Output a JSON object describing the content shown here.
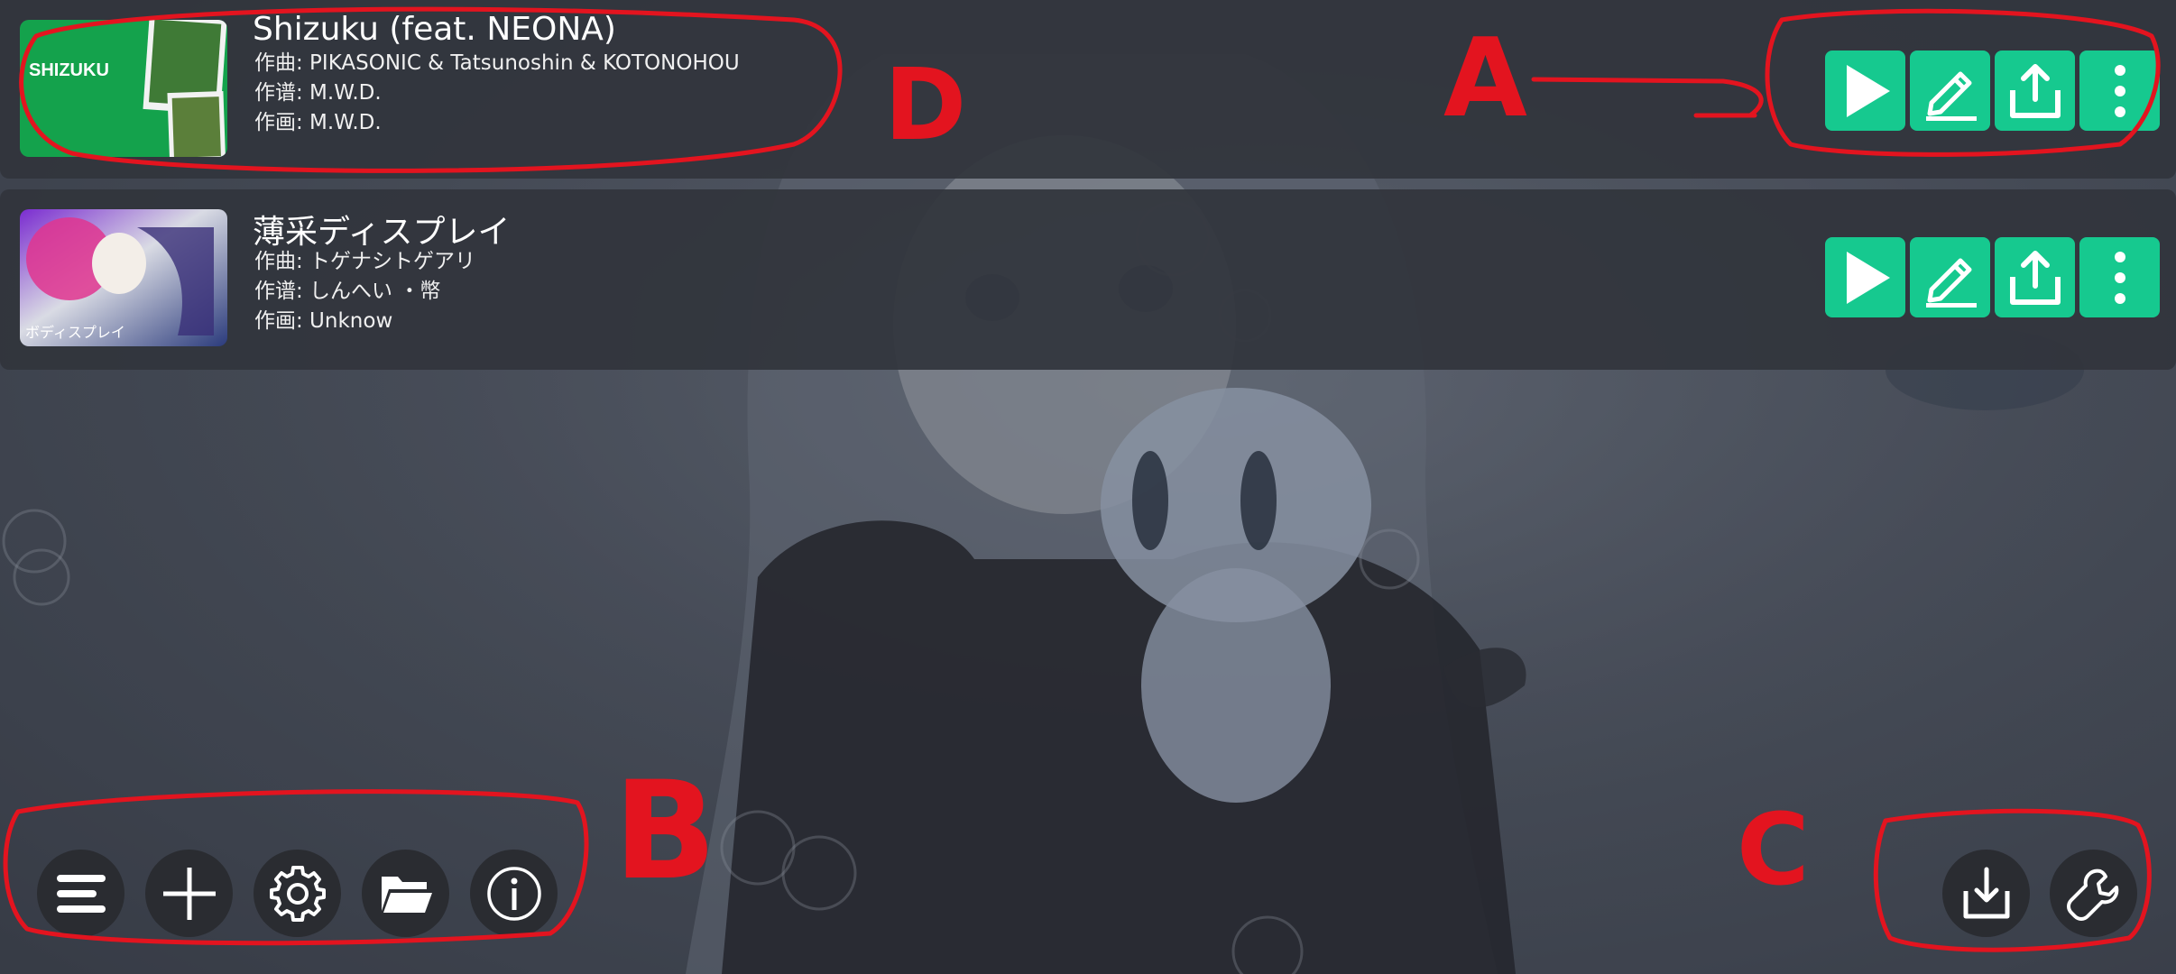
{
  "songs": [
    {
      "title": "Shizuku (feat. NEONA)",
      "composer": "作曲: PIKASONIC & Tatsunoshin & KOTONOHOU",
      "charter": "作谱: M.W.D.",
      "illustrator": "作画: M.W.D.",
      "cover_text": "SHIZUKU",
      "cover_color": "#14a24c"
    },
    {
      "title": "薄采ディスプレイ",
      "composer": "作曲: トゲナシトゲアリ",
      "charter": "作谱: しんへい ・幣",
      "illustrator": "作画: Unknow",
      "cover_text": "ボディスプレイ",
      "cover_color": "#6b2fb8"
    }
  ],
  "song_actions": [
    "play-icon",
    "edit-icon",
    "share-icon",
    "more-vertical-icon"
  ],
  "bottom_left_buttons": [
    "menu-icon",
    "add-icon",
    "settings-icon",
    "folder-icon",
    "info-icon"
  ],
  "bottom_right_buttons": [
    "download-icon",
    "wrench-icon"
  ],
  "annotations": {
    "a": "A",
    "b": "B",
    "c": "C",
    "d": "D",
    "color": "#e3141f"
  },
  "colors": {
    "action_button": "#16c98f",
    "card_background": "#32353c",
    "round_button": "#2a2c31"
  }
}
